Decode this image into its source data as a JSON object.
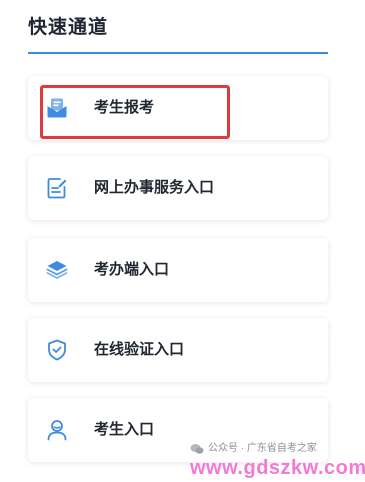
{
  "section": {
    "title": "快速通道"
  },
  "items": [
    {
      "label": "考生报考",
      "icon": "mail-envelope-icon"
    },
    {
      "label": "网上办事服务入口",
      "icon": "document-edit-icon"
    },
    {
      "label": "考办端入口",
      "icon": "layers-icon"
    },
    {
      "label": "在线验证入口",
      "icon": "shield-check-icon"
    },
    {
      "label": "考生入口",
      "icon": "user-icon"
    }
  ],
  "watermark": {
    "account": "公众号 · 广东省自考之家",
    "url": "www.gdszkw.com"
  },
  "colors": {
    "accent": "#3a86e0",
    "icon": "#3f8be0",
    "highlight": "#e0393e",
    "watermark_url": "#f07ad6"
  }
}
